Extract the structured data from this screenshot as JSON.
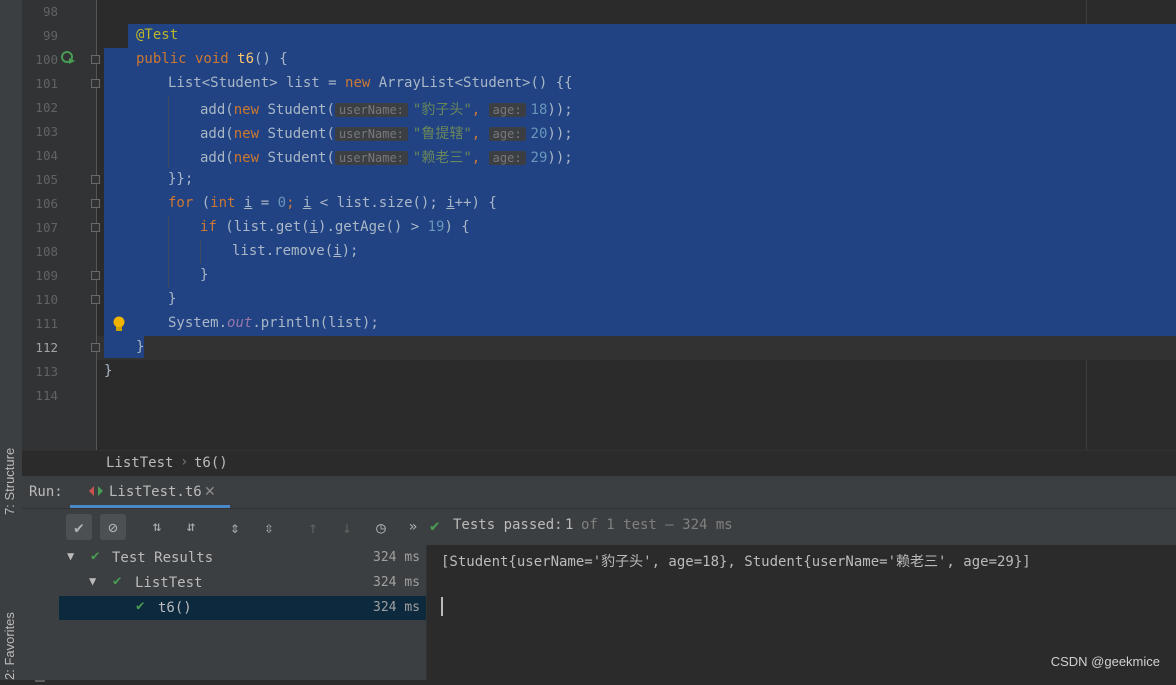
{
  "editor": {
    "line_numbers": [
      "98",
      "99",
      "100",
      "101",
      "102",
      "103",
      "104",
      "105",
      "106",
      "107",
      "108",
      "109",
      "110",
      "111",
      "112",
      "113",
      "114"
    ],
    "code": {
      "ann": "@Test",
      "l100_kw": "public void ",
      "l100_fn": "t6",
      "l100_rest": "() {",
      "l101_a": "List<Student> list = ",
      "l101_kw": "new",
      "l101_b": " ArrayList<Student>() {{",
      "add": "add(",
      "new": "new",
      "student_open": " Student(",
      "hint_user": "userName:",
      "hint_age": "age:",
      "name1": "\"豹子头\"",
      "name2": "\"鲁提辖\"",
      "name3": "\"赖老三\"",
      "age1": "18",
      "age2": "20",
      "age3": "29",
      "close_call": "));",
      "comma": ",",
      "l105": "}};",
      "l106_kw": "for",
      "l106_a": " (",
      "l106_int": "int",
      "l106_i": "i",
      "l106_eq": " = ",
      "l106_zero": "0",
      "l106_semi": "; ",
      "l106_lt": " < list.size(); ",
      "l106_inc": "++) {",
      "l107_kw": "if",
      "l107_a": " (list.get(",
      "l107_b": ").getAge() > ",
      "l107_num": "19",
      "l107_c": ") {",
      "l108_a": "list.remove(",
      "l108_b": ");",
      "close_brace": "}",
      "l111_a": "System.",
      "l111_fld": "out",
      "l111_b": ".println(list);"
    }
  },
  "breadcrumb": {
    "class_name": "ListTest",
    "method_name": "t6()"
  },
  "run": {
    "label": "Run:",
    "tab_title": "ListTest.t6",
    "status_passed": "Tests passed:",
    "status_count": "1",
    "status_rest": "of 1 test – 324 ms",
    "tree": [
      {
        "label": "Test Results",
        "time": "324 ms"
      },
      {
        "label": "ListTest",
        "time": "324 ms"
      },
      {
        "label": "t6()",
        "time": "324 ms"
      }
    ],
    "output": "[Student{userName='豹子头', age=18}, Student{userName='赖老三', age=29}]"
  },
  "side_tabs": {
    "structure": "7: Structure",
    "favorites": "2: Favorites"
  },
  "watermark": "CSDN @geekmice",
  "colors": {
    "selection": "#214283",
    "background": "#2b2b2b",
    "pass_green": "#499c54"
  }
}
